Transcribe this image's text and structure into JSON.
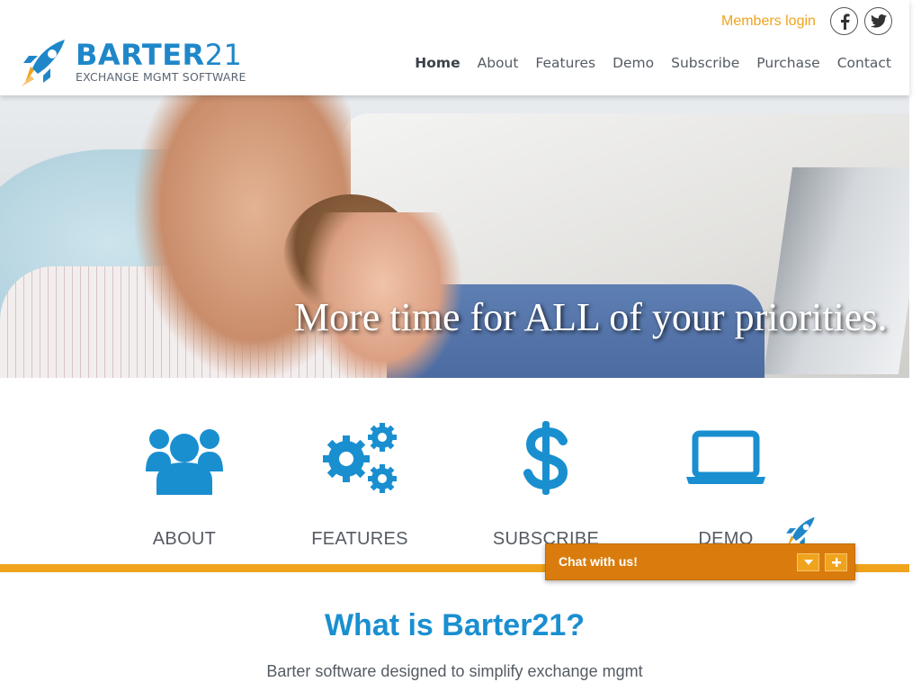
{
  "header": {
    "logo": {
      "name_text": "BARTER",
      "name_number": "21",
      "tagline": "EXCHANGE MGMT SOFTWARE"
    },
    "members_login": "Members login",
    "social": {
      "facebook_icon": "facebook-icon",
      "twitter_icon": "twitter-icon"
    },
    "nav": [
      {
        "label": "Home",
        "active": true
      },
      {
        "label": "About",
        "active": false
      },
      {
        "label": "Features",
        "active": false
      },
      {
        "label": "Demo",
        "active": false
      },
      {
        "label": "Subscribe",
        "active": false
      },
      {
        "label": "Purchase",
        "active": false
      },
      {
        "label": "Contact",
        "active": false
      }
    ]
  },
  "hero": {
    "tagline": "More time for ALL of your priorities."
  },
  "features": [
    {
      "label": "ABOUT",
      "icon": "users-icon"
    },
    {
      "label": "FEATURES",
      "icon": "gears-icon"
    },
    {
      "label": "SUBSCRIBE",
      "icon": "dollar-icon"
    },
    {
      "label": "DEMO",
      "icon": "laptop-icon"
    }
  ],
  "chat": {
    "label": "Chat with us!",
    "minimize_icon": "caret-down-icon",
    "expand_icon": "plus-icon"
  },
  "what_is": {
    "title": "What is Barter21?",
    "subtitle": "Barter software designed to simplify exchange mgmt"
  },
  "colors": {
    "brand_blue": "#1a8fd0",
    "accent_orange": "#f0a31d",
    "chat_orange": "#d97c0d",
    "text_gray": "#555b63"
  }
}
